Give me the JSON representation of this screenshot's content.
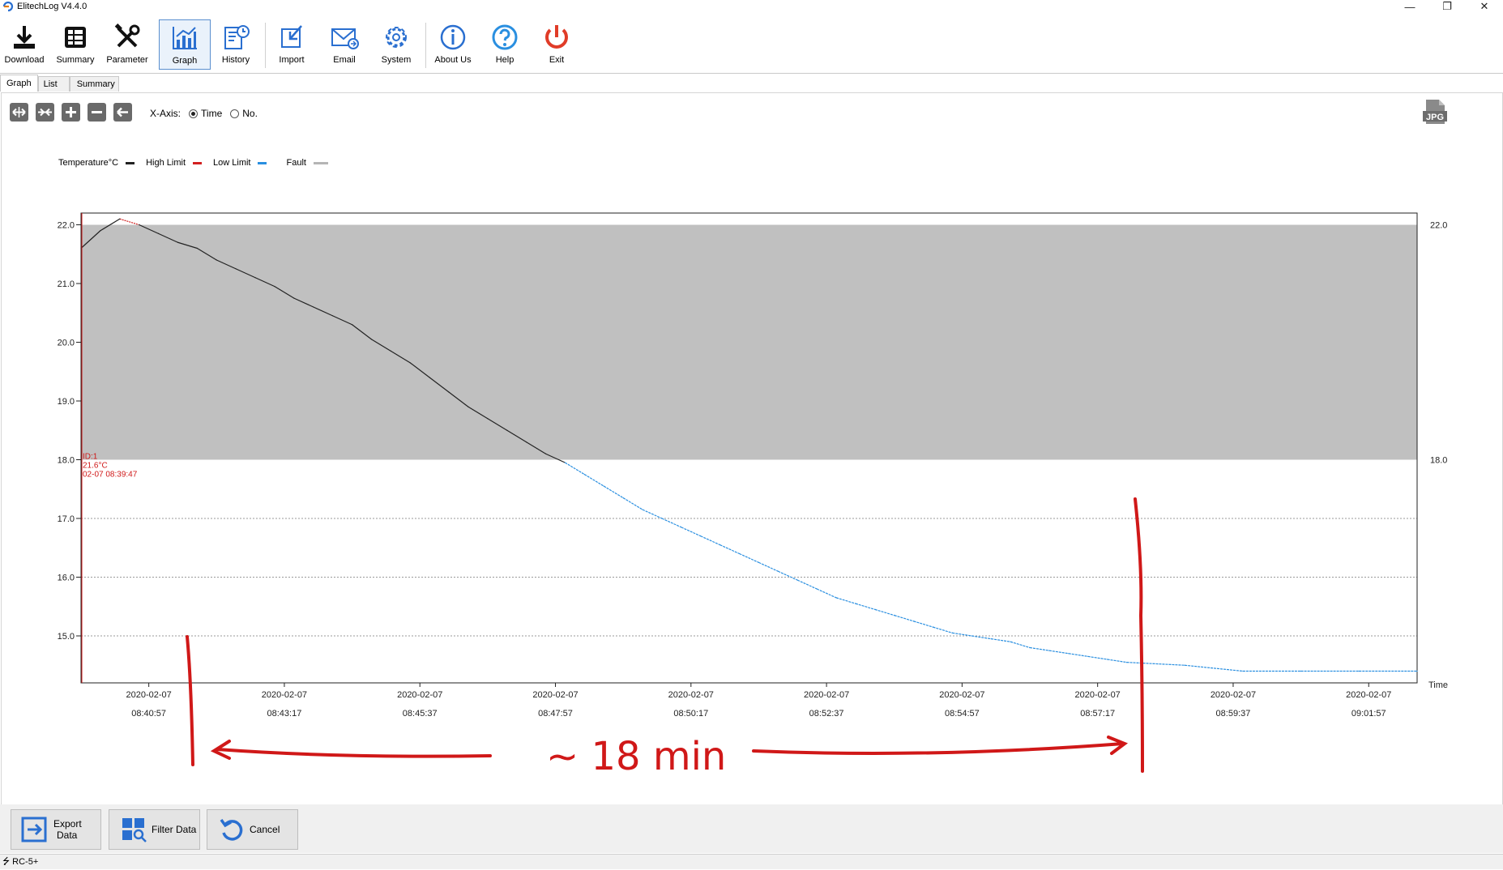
{
  "window": {
    "title": "ElitechLog V4.4.0",
    "minimize": "—",
    "restore": "❐",
    "close": "✕"
  },
  "toolbar": {
    "items": [
      {
        "label": "Download",
        "icon": "download-icon"
      },
      {
        "label": "Summary",
        "icon": "summary-icon"
      },
      {
        "label": "Parameter",
        "icon": "parameter-icon"
      },
      {
        "label": "Graph",
        "icon": "graph-icon",
        "active": true
      },
      {
        "label": "History",
        "icon": "history-icon"
      },
      {
        "label": "Import",
        "icon": "import-icon"
      },
      {
        "label": "Email",
        "icon": "email-icon"
      },
      {
        "label": "System",
        "icon": "system-icon"
      },
      {
        "label": "About Us",
        "icon": "about-icon"
      },
      {
        "label": "Help",
        "icon": "help-icon"
      },
      {
        "label": "Exit",
        "icon": "exit-icon"
      }
    ]
  },
  "tabs": [
    {
      "label": "Graph",
      "active": true
    },
    {
      "label": "List"
    },
    {
      "label": "Summary"
    }
  ],
  "graph_controls": {
    "xaxis_label": "X-Axis:",
    "option_time": "Time",
    "option_no": "No.",
    "selected": "Time",
    "jpg_label": "JPG"
  },
  "legend": {
    "temperature": "Temperature°C",
    "high_limit": "High Limit",
    "low_limit": "Low Limit",
    "fault": "Fault"
  },
  "colors": {
    "temperature_line": "#222222",
    "high_limit": "#d22020",
    "low_limit": "#2a8fe0",
    "fault_band": "#c0c0c0",
    "annotation": "#d01818"
  },
  "chart_data": {
    "type": "line",
    "title": "",
    "xlabel": "Time",
    "ylabel": "",
    "ylim": [
      14.2,
      22.2
    ],
    "yticks": [
      "22.0",
      "21.0",
      "20.0",
      "19.0",
      "18.0",
      "17.0",
      "16.0",
      "15.0"
    ],
    "right_ticks": [
      "22.0",
      "18.0"
    ],
    "high_limit": 22.0,
    "low_limit": 18.0,
    "x_ticks": [
      {
        "date": "2020-02-07",
        "time": "08:40:57"
      },
      {
        "date": "2020-02-07",
        "time": "08:43:17"
      },
      {
        "date": "2020-02-07",
        "time": "08:45:37"
      },
      {
        "date": "2020-02-07",
        "time": "08:47:57"
      },
      {
        "date": "2020-02-07",
        "time": "08:50:17"
      },
      {
        "date": "2020-02-07",
        "time": "08:52:37"
      },
      {
        "date": "2020-02-07",
        "time": "08:54:57"
      },
      {
        "date": "2020-02-07",
        "time": "08:57:17"
      },
      {
        "date": "2020-02-07",
        "time": "08:59:37"
      },
      {
        "date": "2020-02-07",
        "time": "09:01:57"
      }
    ],
    "series": [
      {
        "x": [
          "08:39:47",
          "08:40:07",
          "08:40:27",
          "08:40:47",
          "08:41:07",
          "08:41:27",
          "08:41:47",
          "08:42:07",
          "08:42:27",
          "08:42:47",
          "08:43:07",
          "08:43:27",
          "08:43:47",
          "08:44:07",
          "08:44:27",
          "08:44:47",
          "08:45:07",
          "08:45:27",
          "08:45:47",
          "08:46:07",
          "08:46:27",
          "08:46:47",
          "08:47:07",
          "08:47:27",
          "08:47:47",
          "08:48:07",
          "08:48:27",
          "08:48:47",
          "08:49:07",
          "08:49:27",
          "08:49:47",
          "08:50:07",
          "08:50:27",
          "08:50:47",
          "08:51:07",
          "08:51:27",
          "08:51:47",
          "08:52:07",
          "08:52:27",
          "08:52:47",
          "08:53:07",
          "08:53:27",
          "08:53:47",
          "08:54:07",
          "08:54:27",
          "08:54:47",
          "08:55:07",
          "08:55:27",
          "08:55:47",
          "08:56:07",
          "08:56:27",
          "08:56:47",
          "08:57:07",
          "08:57:27",
          "08:57:47",
          "08:58:47",
          "08:59:47",
          "09:00:47",
          "09:01:47",
          "09:02:47"
        ],
        "values": [
          21.6,
          21.9,
          22.1,
          22.0,
          21.85,
          21.7,
          21.6,
          21.4,
          21.25,
          21.1,
          20.95,
          20.75,
          20.6,
          20.45,
          20.3,
          20.05,
          19.85,
          19.65,
          19.4,
          19.15,
          18.9,
          18.7,
          18.5,
          18.3,
          18.1,
          17.95,
          17.75,
          17.55,
          17.35,
          17.15,
          17.0,
          16.85,
          16.7,
          16.55,
          16.4,
          16.25,
          16.1,
          15.95,
          15.8,
          15.65,
          15.55,
          15.45,
          15.35,
          15.25,
          15.15,
          15.05,
          15.0,
          14.95,
          14.9,
          14.8,
          14.75,
          14.7,
          14.65,
          14.6,
          14.55,
          14.5,
          14.4,
          14.4,
          14.4,
          14.4
        ]
      }
    ],
    "x_start": "08:39:47",
    "x_end": "09:02:47",
    "marker": {
      "id_label": "ID:1",
      "value_label": "21.6°C",
      "time_label": "02-07 08:39:47",
      "x": "08:39:47"
    }
  },
  "annotation": {
    "text": "~ 18 min"
  },
  "bottom_buttons": {
    "export_line1": "Export",
    "export_line2": "Data",
    "filter": "Filter Data",
    "cancel": "Cancel"
  },
  "status": {
    "device": "RC-5+"
  }
}
